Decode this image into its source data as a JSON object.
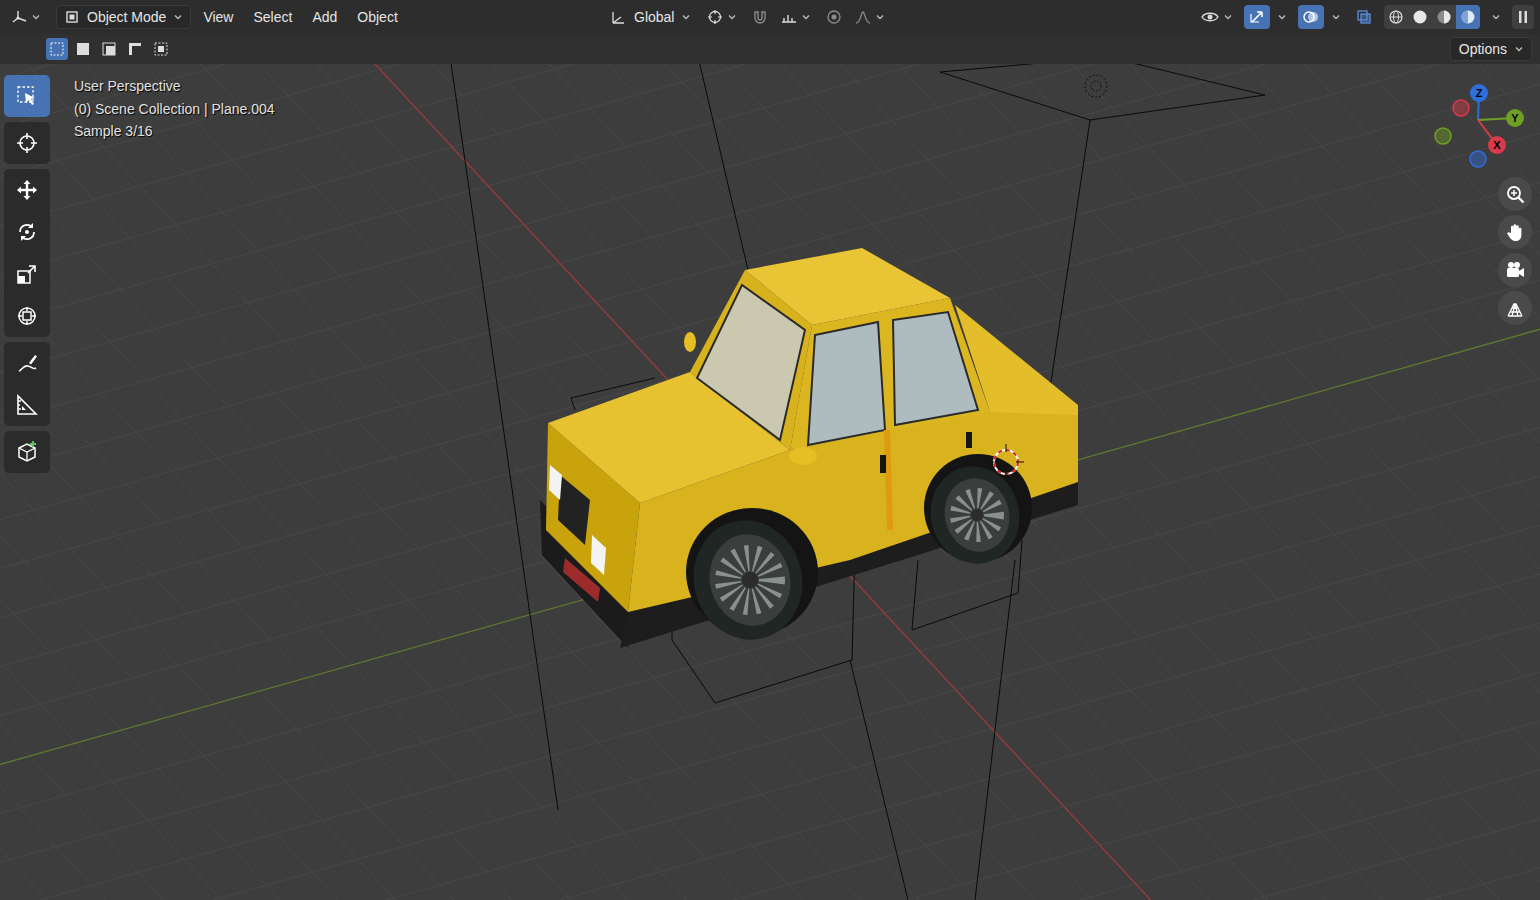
{
  "header": {
    "mode": {
      "label": "Object Mode"
    },
    "menus": [
      "View",
      "Select",
      "Add",
      "Object"
    ],
    "orientation": {
      "label": "Global"
    },
    "snapping": {
      "on": false
    },
    "proportional_editing": {
      "on": false
    },
    "gizmos": {
      "on": true
    },
    "overlays": {
      "on": true
    },
    "xray": {
      "on": false
    },
    "shading_modes": [
      {
        "selected": false
      },
      {
        "selected": false
      },
      {
        "selected": false
      },
      {
        "selected": true
      }
    ]
  },
  "tool_settings": {
    "selection_modes": [
      {
        "selected": true
      },
      {
        "selected": false
      },
      {
        "selected": false
      },
      {
        "selected": false
      },
      {
        "selected": false
      }
    ],
    "options": "Options"
  },
  "toolbar": {
    "tools": [
      {
        "selected": true
      },
      {
        "selected": false
      },
      {
        "selected": false
      },
      {
        "selected": false
      },
      {
        "selected": false
      },
      {
        "selected": false
      },
      {
        "selected": false
      },
      {
        "selected": false
      },
      {
        "selected": false
      }
    ]
  },
  "viewport": {
    "view_name": "User Perspective",
    "collection": "(0) Scene Collection | Plane.004",
    "sample": "Sample 3/16"
  },
  "nav_gizmo": {
    "axes": [
      {
        "label": "Z",
        "color": "#2f6fdc"
      },
      {
        "label": "Y",
        "color": "#6ea024"
      },
      {
        "label": "X",
        "color": "#d93a49"
      }
    ]
  }
}
